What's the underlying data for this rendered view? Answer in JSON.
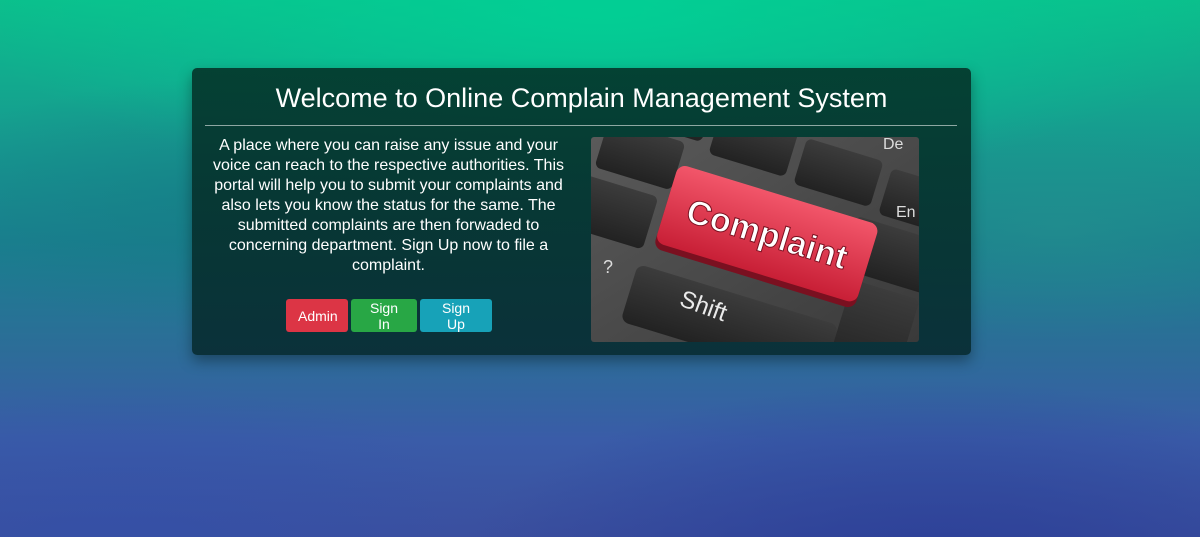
{
  "card": {
    "title": "Welcome to Online Complain Management System",
    "description": "A place where you can raise any issue and your voice can reach to the respective authorities. This portal will help you to submit your complaints and also lets you know the status for the same. The submitted complaints are then forwaded to concerning department. Sign Up now to file a complaint.",
    "buttons": {
      "admin": "Admin",
      "sign_in": "Sign In",
      "sign_up": "Sign Up"
    },
    "image": {
      "key_label": "Complaint",
      "shift_label": "Shift",
      "question_label": "?",
      "enter_label": "En",
      "delete_label": "De"
    }
  },
  "colors": {
    "admin": "#dc3545",
    "sign_in": "#28a745",
    "sign_up": "#17a2b8",
    "complaint_key": "#e8334a"
  }
}
